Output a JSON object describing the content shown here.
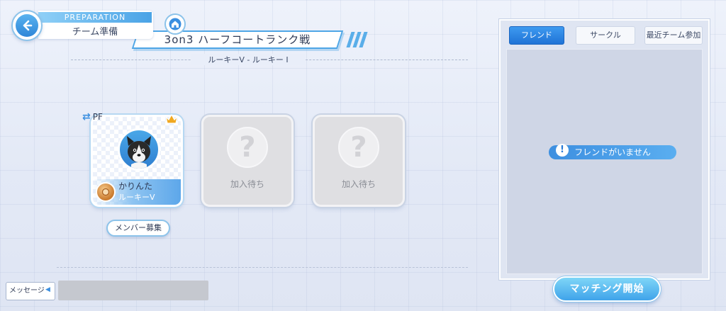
{
  "header": {
    "section_label": "PREPARATION",
    "page_title": "チーム準備",
    "mode_title": "3on3 ハーフコートランク戦",
    "league_range": "ルーキーV - ルーキー I"
  },
  "team": {
    "leader": {
      "position": "PF",
      "name": "かりんた",
      "rank": "ルーキーV"
    },
    "empty_slots": [
      {
        "label": "加入待ち"
      },
      {
        "label": "加入待ち"
      }
    ],
    "recruit_button": "メンバー募集"
  },
  "message": {
    "label": "メッセージ"
  },
  "panel": {
    "tabs": [
      {
        "label": "フレンド",
        "active": true
      },
      {
        "label": "サークル",
        "active": false
      },
      {
        "label": "最近チーム参加",
        "active": false
      }
    ],
    "empty_notice": "フレンドがいません"
  },
  "actions": {
    "start_matching": "マッチング開始"
  },
  "colors": {
    "accent": "#3e9af0",
    "panel_bg": "#dfe5f2",
    "empty_card": "#dfdfe2"
  },
  "icons": [
    "back-arrow-icon",
    "home-icon",
    "swap-icon",
    "crown-icon",
    "question-icon",
    "rank-medal-icon",
    "info-icon"
  ]
}
